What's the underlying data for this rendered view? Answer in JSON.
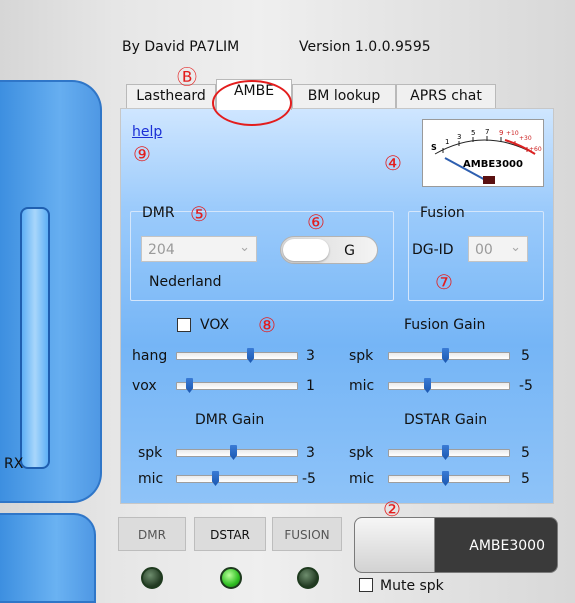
{
  "header": {
    "author": "By David PA7LIM",
    "version": "Version 1.0.0.9595"
  },
  "tabs": [
    {
      "label": "Lastheard"
    },
    {
      "label": "AMBE"
    },
    {
      "label": "BM lookup"
    },
    {
      "label": "APRS chat"
    }
  ],
  "left_panel": {
    "rx_label": "RX"
  },
  "main": {
    "help_link": "help",
    "meter": {
      "scale": [
        "S",
        "1",
        "3",
        "5",
        "7",
        "9",
        "+10",
        "+30",
        "+60"
      ],
      "label": "AMBE3000"
    },
    "dmr": {
      "group_title": "DMR",
      "select_value": "204",
      "country": "Nederland",
      "toggle_label": "G"
    },
    "fusion": {
      "group_title": "Fusion",
      "dgid_label": "DG-ID",
      "dgid_value": "00"
    },
    "vox": {
      "label": "VOX",
      "checked": false,
      "hang": {
        "label": "hang",
        "value": "3",
        "level": 0.62
      },
      "vox": {
        "label": "vox",
        "value": "1",
        "level": 0.08
      }
    },
    "fusion_gain": {
      "title": "Fusion Gain",
      "spk": {
        "label": "spk",
        "value": "5",
        "level": 0.47
      },
      "mic": {
        "label": "mic",
        "value": "-5",
        "level": 0.31
      }
    },
    "dmr_gain": {
      "title": "DMR Gain",
      "spk": {
        "label": "spk",
        "value": "3",
        "level": 0.47
      },
      "mic": {
        "label": "mic",
        "value": "-5",
        "level": 0.31
      }
    },
    "dstar_gain": {
      "title": "DSTAR Gain",
      "spk": {
        "label": "spk",
        "value": "5",
        "level": 0.47
      },
      "mic": {
        "label": "mic",
        "value": "5",
        "level": 0.47
      }
    }
  },
  "annotations": [
    "Ⓑ",
    "⑨",
    "④",
    "⑤",
    "⑥",
    "⑦",
    "⑧",
    "②"
  ],
  "bottom": {
    "modes": [
      {
        "label": "DMR",
        "led": "#1f3a1f"
      },
      {
        "label": "DSTAR",
        "led": "#39c92b"
      },
      {
        "label": "FUSION",
        "led": "#1f3a1f"
      }
    ],
    "big_button_label": "AMBE3000",
    "mute_label": "Mute spk",
    "mute_checked": false
  },
  "colors": {
    "accent": "#3d8fe0",
    "annotation": "#e31d1d",
    "link": "#1a2fd6"
  }
}
